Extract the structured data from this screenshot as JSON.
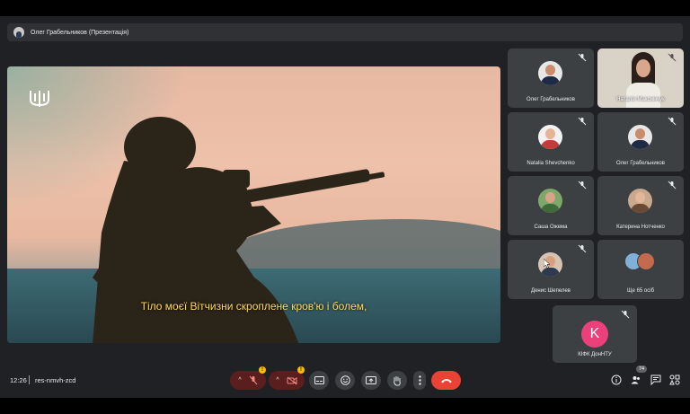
{
  "presentation_bar": {
    "title": "Олег Грабельников (Презентація)"
  },
  "main_video": {
    "subtitle": "Тіло моєї Вітчизни скроплене кров'ю і болем,"
  },
  "participants": [
    {
      "name": "Олег Грабельников"
    },
    {
      "name": "Наталія Максимчук"
    },
    {
      "name": "Natalia Shevchenko"
    },
    {
      "name": "Олег Грабельников"
    },
    {
      "name": "Саша Ожема"
    },
    {
      "name": "Катерина Нотченко"
    },
    {
      "name": "Денис Шепелев"
    },
    {
      "name": "Ще 65 осіб"
    },
    {
      "name": "КІФК ДонНТУ",
      "initial": "K"
    }
  ],
  "bottom_bar": {
    "time": "12:26",
    "meeting_code": "res-nmvh-zcd",
    "people_count": "74",
    "warning_badge": "!"
  },
  "icons": [
    "trident-logo-icon",
    "mic-off-icon",
    "camera-off-icon",
    "captions-icon",
    "emoji-icon",
    "present-icon",
    "raise-hand-icon",
    "more-options-icon",
    "end-call-icon",
    "info-icon",
    "people-icon",
    "chat-icon",
    "activities-icon"
  ],
  "colors": {
    "accent_red": "#ea4335",
    "warning": "#fbbc04",
    "avatar_pink": "#ec407a",
    "subtitle": "#ffd95c"
  }
}
